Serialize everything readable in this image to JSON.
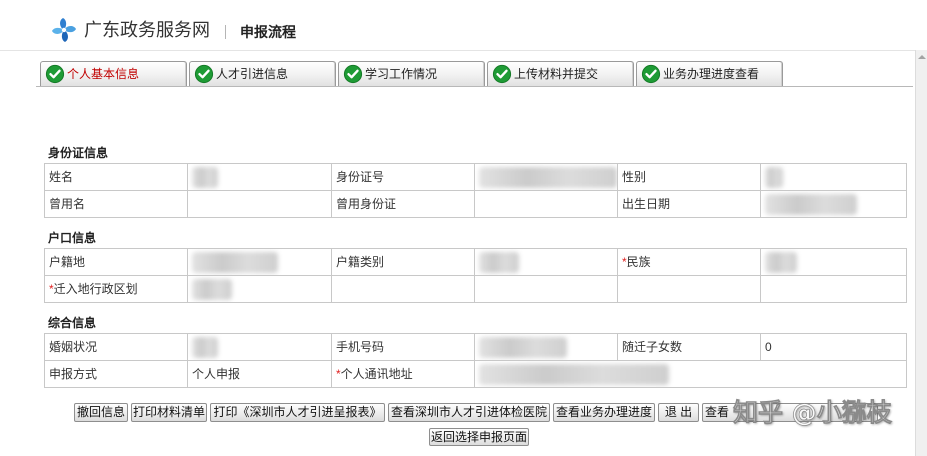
{
  "header": {
    "site_name": "广东政务服务网",
    "page_title": "申报流程",
    "logo_icon": "guangdong-gov-flower-logo"
  },
  "colors": {
    "active_tab_text": "#c00000",
    "required_mark": "#e02020",
    "check_green": "#1e9b35",
    "logo_blue": "#2f7fd0"
  },
  "active_tab_index": 0,
  "tabs": [
    {
      "label": "个人基本信息",
      "icon": "check-circle-icon"
    },
    {
      "label": "人才引进信息",
      "icon": "check-circle-icon"
    },
    {
      "label": "学习工作情况",
      "icon": "check-circle-icon"
    },
    {
      "label": "上传材料并提交",
      "icon": "check-circle-icon"
    },
    {
      "label": "业务办理进度查看",
      "icon": "check-circle-icon"
    }
  ],
  "id_section": {
    "title": "身份证信息",
    "name_label": "姓名",
    "id_number_label": "身份证号",
    "gender_label": "性别",
    "former_name_label": "曾用名",
    "former_id_label": "曾用身份证",
    "birth_date_label": "出生日期"
  },
  "hukou_section": {
    "title": "户口信息",
    "hukou_place_label": "户籍地",
    "hukou_type_label": "户籍类别",
    "ethnicity_required": "*",
    "ethnicity_label": "民族",
    "move_in_required": "*",
    "move_in_region_label": "迁入地行政区划"
  },
  "general_section": {
    "title": "综合信息",
    "marital_label": "婚姻状况",
    "mobile_label": "手机号码",
    "children_label": "随迁子女数",
    "children_value": "0",
    "apply_method_label": "申报方式",
    "apply_method_value": "个人申报",
    "address_required": "*",
    "address_label": "个人通讯地址"
  },
  "buttons": {
    "withdraw": "撤回信息",
    "print_checklist": "打印材料清单",
    "print_report": "打印《深圳市人才引进呈报表》",
    "view_hospitals": "查看深圳市人才引进体检医院",
    "view_progress": "查看业务办理进度",
    "exit": "退 出",
    "view_more": "查看",
    "back": "返回选择申报页面"
  },
  "watermark": "知乎 @小猕枝"
}
